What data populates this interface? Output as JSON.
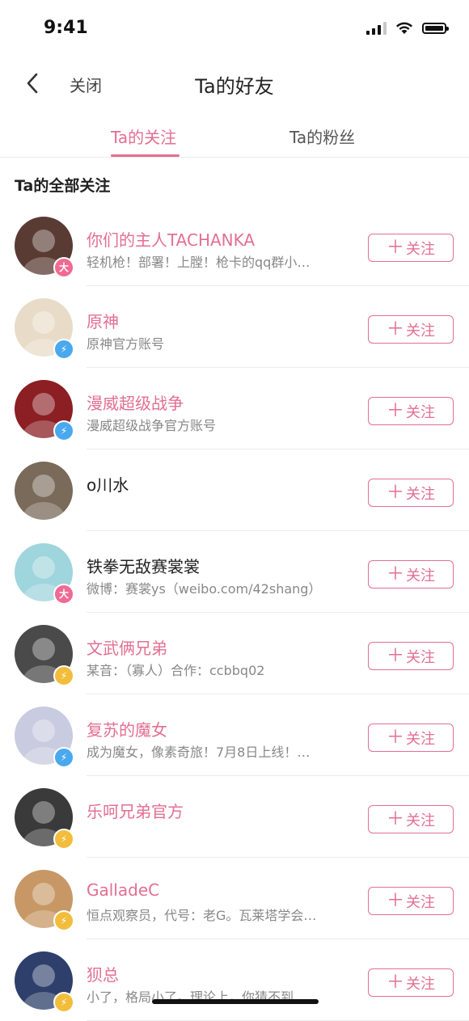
{
  "status_bar": {
    "time": "9:41"
  },
  "nav": {
    "close_label": "关闭",
    "title": "Ta的好友"
  },
  "tabs": [
    {
      "label": "Ta的关注",
      "active": true
    },
    {
      "label": "Ta的粉丝",
      "active": false
    }
  ],
  "section_title": "Ta的全部关注",
  "follow_label": "关注",
  "users": [
    {
      "name": "你们的主人TACHANKA",
      "desc": "轻机枪！部署！上膛！枪卡的qq群小…",
      "name_color": "pink",
      "badge": "big",
      "badge_text": "大"
    },
    {
      "name": "原神",
      "desc": "原神官方账号",
      "name_color": "pink",
      "badge": "blue",
      "badge_text": "⚡"
    },
    {
      "name": "漫威超级战争",
      "desc": "漫威超级战争官方账号",
      "name_color": "pink",
      "badge": "blue",
      "badge_text": "⚡"
    },
    {
      "name": "o川水",
      "desc": "",
      "name_color": "dark",
      "badge": "none",
      "badge_text": ""
    },
    {
      "name": "铁拳无敌赛裳裳",
      "desc": "微博：赛裳ys（weibo.com/42shang）",
      "name_color": "dark",
      "badge": "big",
      "badge_text": "大"
    },
    {
      "name": "文武俩兄弟",
      "desc": "某音：（寡人）合作：ccbbq02",
      "name_color": "pink",
      "badge": "gold",
      "badge_text": "⚡"
    },
    {
      "name": "复苏的魔女",
      "desc": "成为魔女，像素奇旅！7月8日上线！…",
      "name_color": "pink",
      "badge": "blue",
      "badge_text": "⚡"
    },
    {
      "name": "乐呵兄弟官方",
      "desc": "",
      "name_color": "pink",
      "badge": "gold",
      "badge_text": "⚡"
    },
    {
      "name": "GalladeC",
      "desc": "恒点观察员，代号：老G。瓦莱塔学会…",
      "name_color": "pink",
      "badge": "gold",
      "badge_text": "⚡"
    },
    {
      "name": "狈总",
      "desc": "小了，格局小了。理论上，你猜不到…",
      "name_color": "pink",
      "badge": "gold",
      "badge_text": "⚡"
    }
  ],
  "colors": {
    "accent": "#e36f93",
    "badge_big": "#f06a94",
    "badge_blue": "#4aa9ee",
    "badge_gold": "#f2bd3c"
  },
  "avatar_colors": [
    "#5a3b33",
    "#e8dcc8",
    "#8b1f24",
    "#7a6a5a",
    "#9fd5dc",
    "#4a4a4a",
    "#c9cbe0",
    "#3a3a3a",
    "#c79866",
    "#2d3f6a"
  ]
}
